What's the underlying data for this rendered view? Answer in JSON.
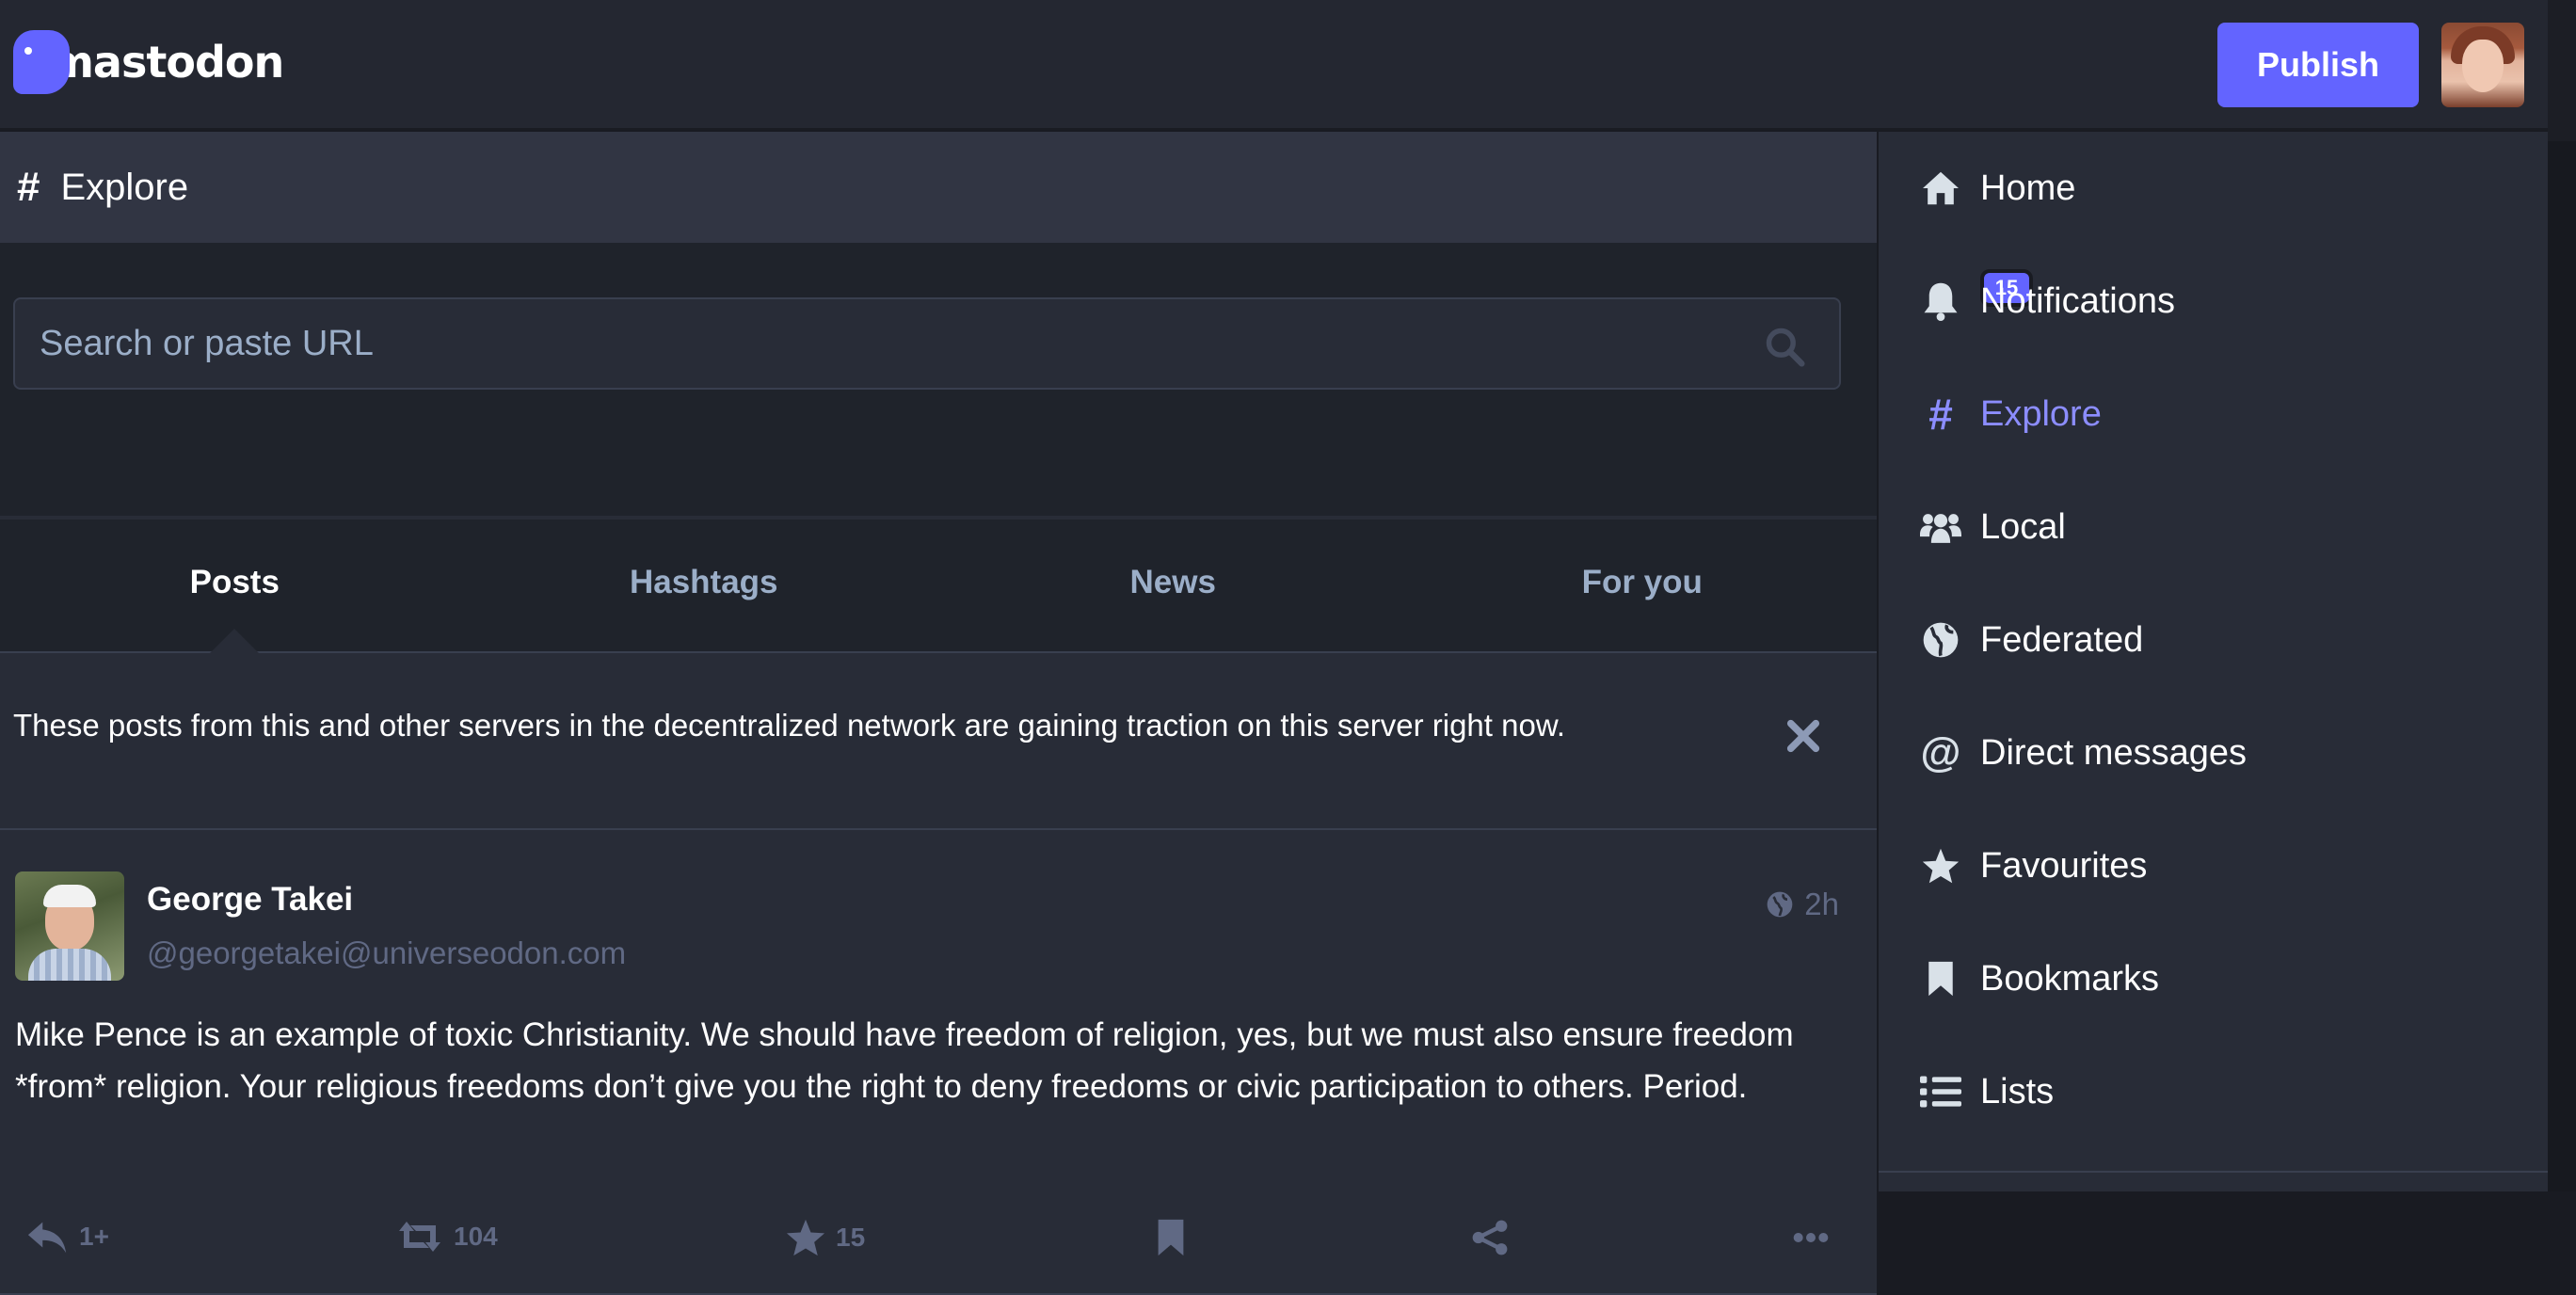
{
  "app": {
    "logo_text": "mastodon",
    "publish_label": "Publish"
  },
  "column": {
    "icon": "hashtag-icon",
    "title": "Explore"
  },
  "search": {
    "placeholder": "Search or paste URL",
    "value": ""
  },
  "tabs": [
    {
      "label": "Posts",
      "active": true
    },
    {
      "label": "Hashtags",
      "active": false
    },
    {
      "label": "News",
      "active": false
    },
    {
      "label": "For you",
      "active": false
    }
  ],
  "notice": {
    "text": "These posts from this and other servers in the decentralized network are gaining traction on this server right now."
  },
  "status": {
    "display_name": "George Takei",
    "account": "@georgetakei@universeodon.com",
    "time": "2h",
    "visibility_icon": "globe-icon",
    "content": "Mike Pence is an example of toxic Christianity. We should have freedom of religion, yes, but we must also ensure freedom *from* religion. Your religious freedoms don’t give you the right to deny freedoms or civic participation to others. Period.",
    "replies": "1+",
    "boosts": "104",
    "favourites": "15"
  },
  "nav": {
    "items": [
      {
        "label": "Home",
        "icon": "home-icon"
      },
      {
        "label": "Notifications",
        "icon": "bell-icon",
        "badge": "15"
      },
      {
        "label": "Explore",
        "icon": "hashtag-icon",
        "active": true
      },
      {
        "label": "Local",
        "icon": "users-icon"
      },
      {
        "label": "Federated",
        "icon": "globe-icon"
      },
      {
        "label": "Direct messages",
        "icon": "at-icon"
      },
      {
        "label": "Favourites",
        "icon": "star-icon"
      },
      {
        "label": "Bookmarks",
        "icon": "bookmark-icon"
      },
      {
        "label": "Lists",
        "icon": "list-icon"
      }
    ]
  },
  "colors": {
    "accent": "#6364ff",
    "active_nav": "#8c8dff",
    "muted_text": "#606984",
    "secondary_text": "#9baec8"
  }
}
